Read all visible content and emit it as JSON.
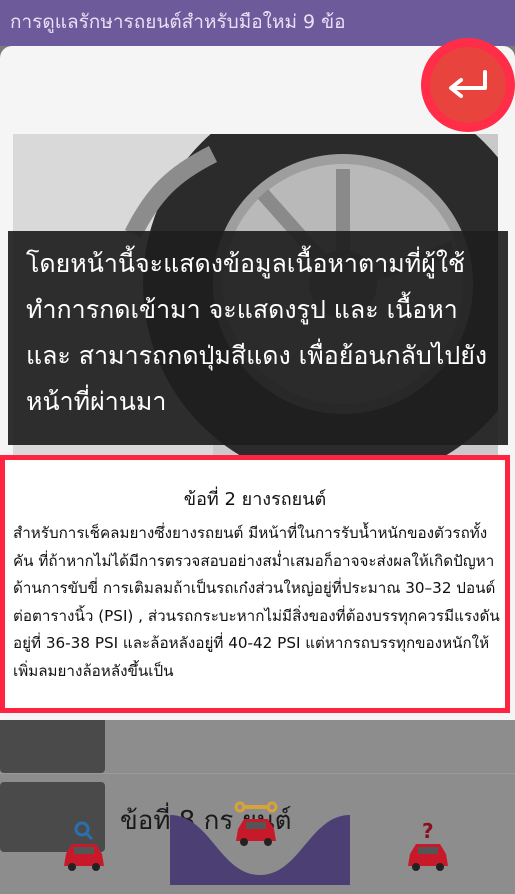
{
  "header": {
    "title": "การดูแลรักษารถยนต์สำหรับมือใหม่ 9 ข้อ"
  },
  "background_list": {
    "visible_item_label": "ข้อที่ 8 กร  ยนต์"
  },
  "overlay_note": {
    "text": "โดยหน้านี้จะแสดงข้อมูลเนื้อหาตามที่ผู้ใช้ทำการกดเข้ามา จะแสดงรูป และ เนื้อหา และ สามารถกดปุ่มสีแดง เพื่อย้อนกลับไปยังหน้าที่ผ่านมา"
  },
  "content": {
    "title": "ข้อที่ 2 ยางรถยนต์",
    "body": "สำหรับการเช็คลมยางซึ่งยางรถยนต์ มีหน้าที่ในการรับน้ำหนักของตัวรถทั้งคัน ที่ถ้าหากไม่ได้มีการตรวจสอบอย่างสม่ำเสมอก็อาจจะส่งผลให้เกิดปัญหาด้านการขับขี่ การเติมลมถ้าเป็นรถเก๋งส่วนใหญ่อยู่ที่ประมาณ 30–32 ปอนด์ต่อตารางนิ้ว (PSI) , ส่วนรถกระบะหากไม่มีสิ่งของที่ต้องบรรทุกควรมีแรงดันอยู่ที่ 36-38 PSI และล้อหลังอยู่ที่ 40-42 PSI แต่หากรถบรรทุกของหนักให้เพิ่มลมยางล้อหลังขึ้นเป็น"
  },
  "icons": {
    "back": "return-arrow-icon",
    "nav_left": "car-search-icon",
    "nav_center": "car-wrench-icon",
    "nav_right": "car-question-icon"
  },
  "colors": {
    "accent_red": "#ff2d48",
    "header_purple": "#6c5a9a"
  }
}
